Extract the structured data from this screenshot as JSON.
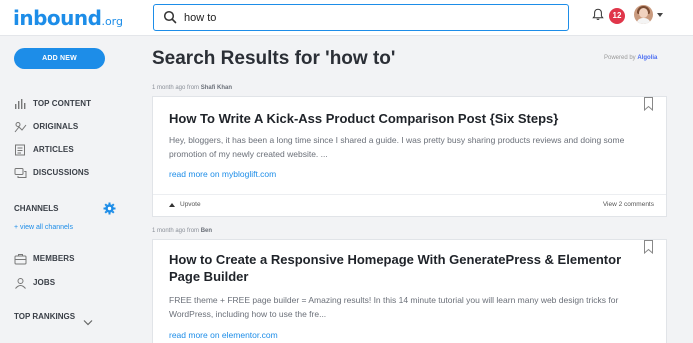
{
  "header": {
    "logo_main": "inbound",
    "logo_suffix": ".org",
    "search_value": "how to",
    "notification_count": "12"
  },
  "sidebar": {
    "add_new_label": "ADD NEW",
    "nav": [
      {
        "label": "TOP CONTENT",
        "icon": "bar-chart-icon"
      },
      {
        "label": "ORIGINALS",
        "icon": "originals-icon"
      },
      {
        "label": "ARTICLES",
        "icon": "article-icon"
      },
      {
        "label": "DISCUSSIONS",
        "icon": "discussion-icon"
      }
    ],
    "channels_title": "CHANNELS",
    "view_all_label": "+ view all channels",
    "community": [
      {
        "label": "MEMBERS",
        "icon": "members-icon"
      },
      {
        "label": "JOBS",
        "icon": "jobs-icon"
      }
    ],
    "top_rankings_label": "TOP RANKINGS"
  },
  "main": {
    "title": "Search Results for 'how to'",
    "powered_by": "Powered by",
    "powered_brand": "Algolia",
    "results": [
      {
        "meta_prefix": "1 month ago from",
        "author": "Shafi Khan",
        "title": "How To Write A Kick-Ass Product Comparison Post {Six Steps}",
        "excerpt": "Hey, bloggers, it has been a long time since I shared a guide. I was pretty busy sharing products reviews and doing some promotion of my newly created website. ...",
        "read_more": "read more on mybloglift.com",
        "upvote_label": "Upvote",
        "comments_label": "View 2 comments"
      },
      {
        "meta_prefix": "1 month ago from",
        "author": "Ben",
        "title": "How to Create a Responsive Homepage With GeneratePress & Elementor Page Builder",
        "excerpt": "FREE theme + FREE page builder = Amazing results! In this 14 minute tutorial you will learn many web design tricks for WordPress, including how to use the fre...",
        "read_more": "read more on elementor.com"
      }
    ]
  },
  "colors": {
    "accent": "#1d8de8",
    "badge": "#e0364a",
    "background": "#f2f3f5"
  }
}
